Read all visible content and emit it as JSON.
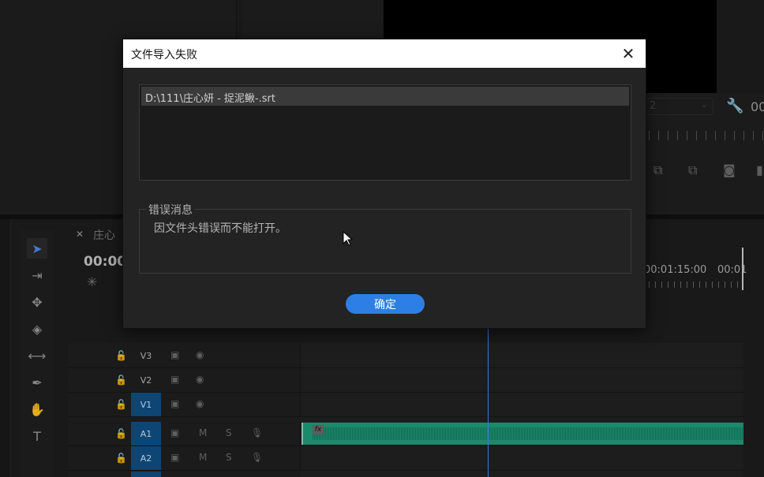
{
  "dialog": {
    "title": "文件导入失败",
    "close_glyph": "✕",
    "file_list": [
      "D:\\111\\庄心妍 - 捉泥鳅-.srt"
    ],
    "error_group_label": "错误消息",
    "error_message": "因文件头错误而不能打开。",
    "ok_label": "确定"
  },
  "program_monitor": {
    "zoom_value": "2",
    "timecode": "00"
  },
  "timeline": {
    "sequence_name": "庄心",
    "timecode": "00:00",
    "ruler_labels": [
      "00:01:15:00",
      "00:01"
    ],
    "video_tracks": [
      "V3",
      "V2",
      "V1"
    ],
    "audio_tracks": [
      "A1",
      "A2"
    ],
    "mute_label": "M",
    "solo_label": "S",
    "clip_fx_label": "fx"
  },
  "colors": {
    "accent": "#2d7fe6",
    "track_target": "#0f4f86",
    "audio_clip": "#1f9c7c",
    "playhead": "#3d8be8"
  },
  "icons": {
    "tools": [
      "selection-tool-icon",
      "track-select-tool-icon",
      "ripple-edit-tool-icon",
      "razor-tool-icon",
      "slip-tool-icon",
      "pen-tool-icon",
      "hand-tool-icon",
      "type-tool-icon"
    ]
  }
}
